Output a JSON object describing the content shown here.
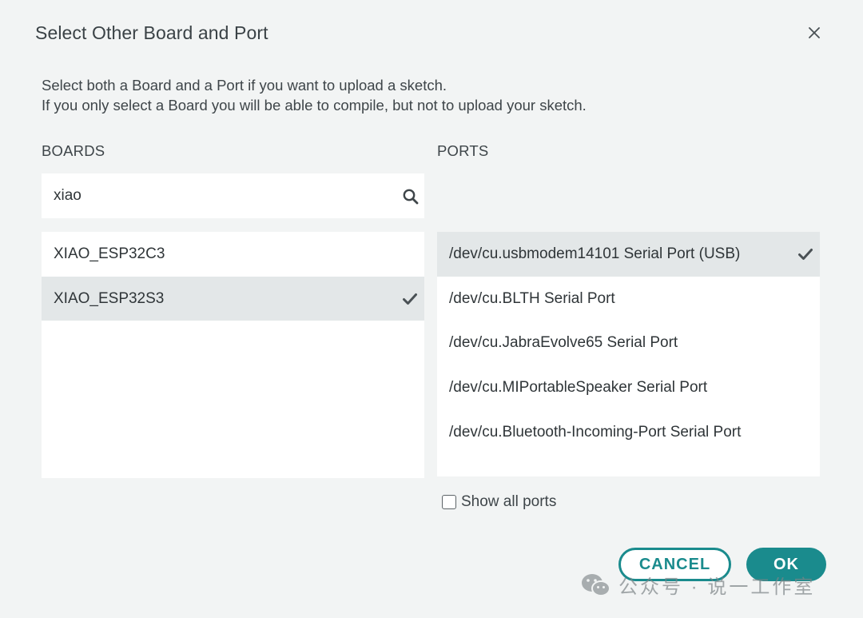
{
  "dialog": {
    "title": "Select Other Board and Port",
    "description_line1": "Select both a Board and a Port if you want to upload a sketch.",
    "description_line2": "If you only select a Board you will be able to compile, but not to upload your sketch."
  },
  "boards": {
    "label": "BOARDS",
    "search_value": "xiao",
    "items": [
      {
        "label": "XIAO_ESP32C3",
        "selected": false
      },
      {
        "label": "XIAO_ESP32S3",
        "selected": true
      }
    ]
  },
  "ports": {
    "label": "PORTS",
    "items": [
      {
        "label": "/dev/cu.usbmodem14101 Serial Port (USB)",
        "selected": true
      },
      {
        "label": "/dev/cu.BLTH Serial Port",
        "selected": false
      },
      {
        "label": "/dev/cu.JabraEvolve65 Serial Port",
        "selected": false
      },
      {
        "label": "/dev/cu.MIPortableSpeaker Serial Port",
        "selected": false
      },
      {
        "label": "/dev/cu.Bluetooth-Incoming-Port Serial Port",
        "selected": false
      }
    ],
    "show_all_label": "Show all ports",
    "show_all_checked": false
  },
  "buttons": {
    "cancel": "CANCEL",
    "ok": "OK"
  },
  "watermark": {
    "text": "公众号 · 说一工作室",
    "icon": "wechat-icon"
  },
  "colors": {
    "accent": "#1a8b8d",
    "selected_row": "#e3e7e8",
    "dialog_bg": "#f2f4f4"
  },
  "icons": {
    "close": "close-icon",
    "search": "search-icon",
    "check": "checkmark-icon"
  }
}
